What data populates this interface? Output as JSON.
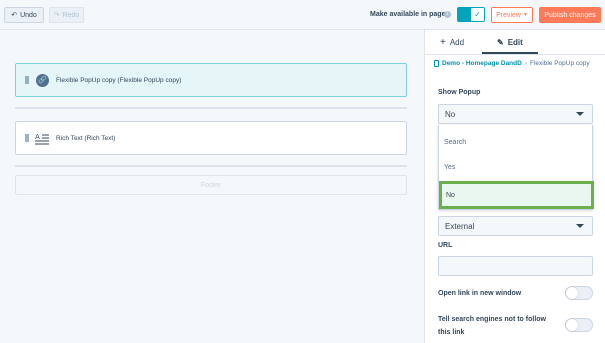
{
  "toolbar": {
    "undo_label": "Undo",
    "redo_label": "Redo",
    "make_available_label": "Make available in pages",
    "preview_label": "Preview",
    "publish_label": "Publish changes"
  },
  "canvas": {
    "modules": [
      {
        "label": "Flexible PopUp copy (Flexible PopUp copy)",
        "icon": "link-icon",
        "selected": true
      },
      {
        "label": "Rich Text (Rich Text)",
        "icon": "rich-text-icon",
        "selected": false
      }
    ],
    "footer_label": "Footer"
  },
  "sidebar": {
    "tabs": [
      {
        "label": "Add",
        "icon": "plus-icon",
        "active": false
      },
      {
        "label": "Edit",
        "icon": "pencil-icon",
        "active": true
      }
    ],
    "breadcrumb": {
      "parent": "Demo - Homepage DandD",
      "current": "Flexible PopUp copy"
    },
    "show_popup": {
      "label": "Show Popup",
      "value": "No",
      "options": [
        "Search",
        "Yes",
        "No"
      ],
      "highlighted": "No"
    },
    "link_type": {
      "value": "External"
    },
    "url": {
      "label": "URL",
      "value": ""
    },
    "open_new_window": {
      "label": "Open link in new window",
      "enabled": false
    },
    "no_follow": {
      "label": "Tell search engines not to follow this link",
      "enabled": false
    }
  },
  "colors": {
    "accent": "#00a4bd",
    "primary_orange": "#ff7a59",
    "highlight_green": "#6ab04c",
    "text": "#33475b"
  }
}
